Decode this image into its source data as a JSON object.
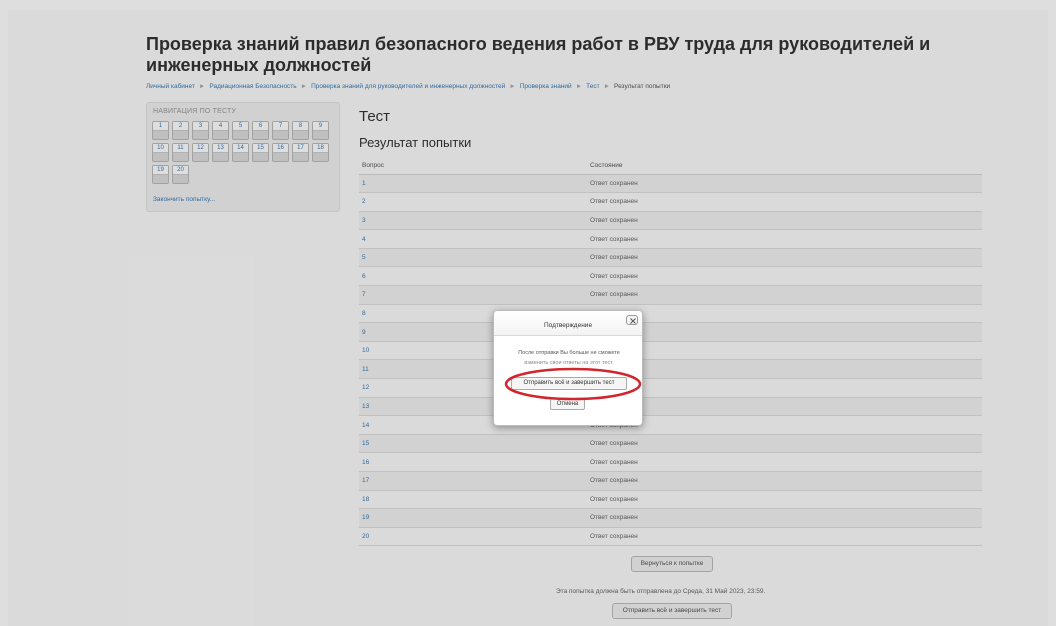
{
  "page": {
    "title": "Проверка знаний правил безопасного ведения работ в РВУ труда для руководителей и инженерных должностей"
  },
  "breadcrumb": [
    {
      "label": "Личный кабинет"
    },
    {
      "label": "Радиационная Безопасность"
    },
    {
      "label": "Проверка знаний для руководителей и инженерных должностей"
    },
    {
      "label": "Проверка знаний"
    },
    {
      "label": "Тест"
    },
    {
      "label": "Результат попытки"
    }
  ],
  "navigation": {
    "header": "НАВИГАЦИЯ ПО ТЕСТУ",
    "questions": [
      "1",
      "2",
      "3",
      "4",
      "5",
      "6",
      "7",
      "8",
      "9",
      "10",
      "11",
      "12",
      "13",
      "14",
      "15",
      "16",
      "17",
      "18",
      "19",
      "20"
    ],
    "finish_link": "Закончить попытку..."
  },
  "main": {
    "heading": "Тест",
    "subheading": "Результат попытки",
    "table": {
      "columns": [
        "Вопрос",
        "Состояние"
      ],
      "rows": [
        {
          "question": "1",
          "state": "Ответ сохранен"
        },
        {
          "question": "2",
          "state": "Ответ сохранен"
        },
        {
          "question": "3",
          "state": "Ответ сохранен"
        },
        {
          "question": "4",
          "state": "Ответ сохранен"
        },
        {
          "question": "5",
          "state": "Ответ сохранен"
        },
        {
          "question": "6",
          "state": "Ответ сохранен"
        },
        {
          "question": "7",
          "state": "Ответ сохранен"
        },
        {
          "question": "8",
          "state": ""
        },
        {
          "question": "9",
          "state": ""
        },
        {
          "question": "10",
          "state": ""
        },
        {
          "question": "11",
          "state": ""
        },
        {
          "question": "12",
          "state": ""
        },
        {
          "question": "13",
          "state": ""
        },
        {
          "question": "14",
          "state": "Ответ сохранен"
        },
        {
          "question": "15",
          "state": "Ответ сохранен"
        },
        {
          "question": "16",
          "state": "Ответ сохранен"
        },
        {
          "question": "17",
          "state": "Ответ сохранен"
        },
        {
          "question": "18",
          "state": "Ответ сохранен"
        },
        {
          "question": "19",
          "state": "Ответ сохранен"
        },
        {
          "question": "20",
          "state": "Ответ сохранен"
        }
      ]
    },
    "return_button": "Вернуться к попытке",
    "deadline_text": "Эта попытка должна быть отправлена до Среда, 31 Май 2023, 23:59.",
    "submit_button": "Отправить всё и завершить тест"
  },
  "dialog": {
    "title": "Подтверждение",
    "message_line1": "После отправки Вы больше не сможете",
    "message_line2": "изменить свои ответы на этот тест.",
    "submit_button": "Отправить всё и завершить тест",
    "cancel_button": "Отмена",
    "close_icon": "close-icon",
    "highlight_color": "#d0262d"
  }
}
